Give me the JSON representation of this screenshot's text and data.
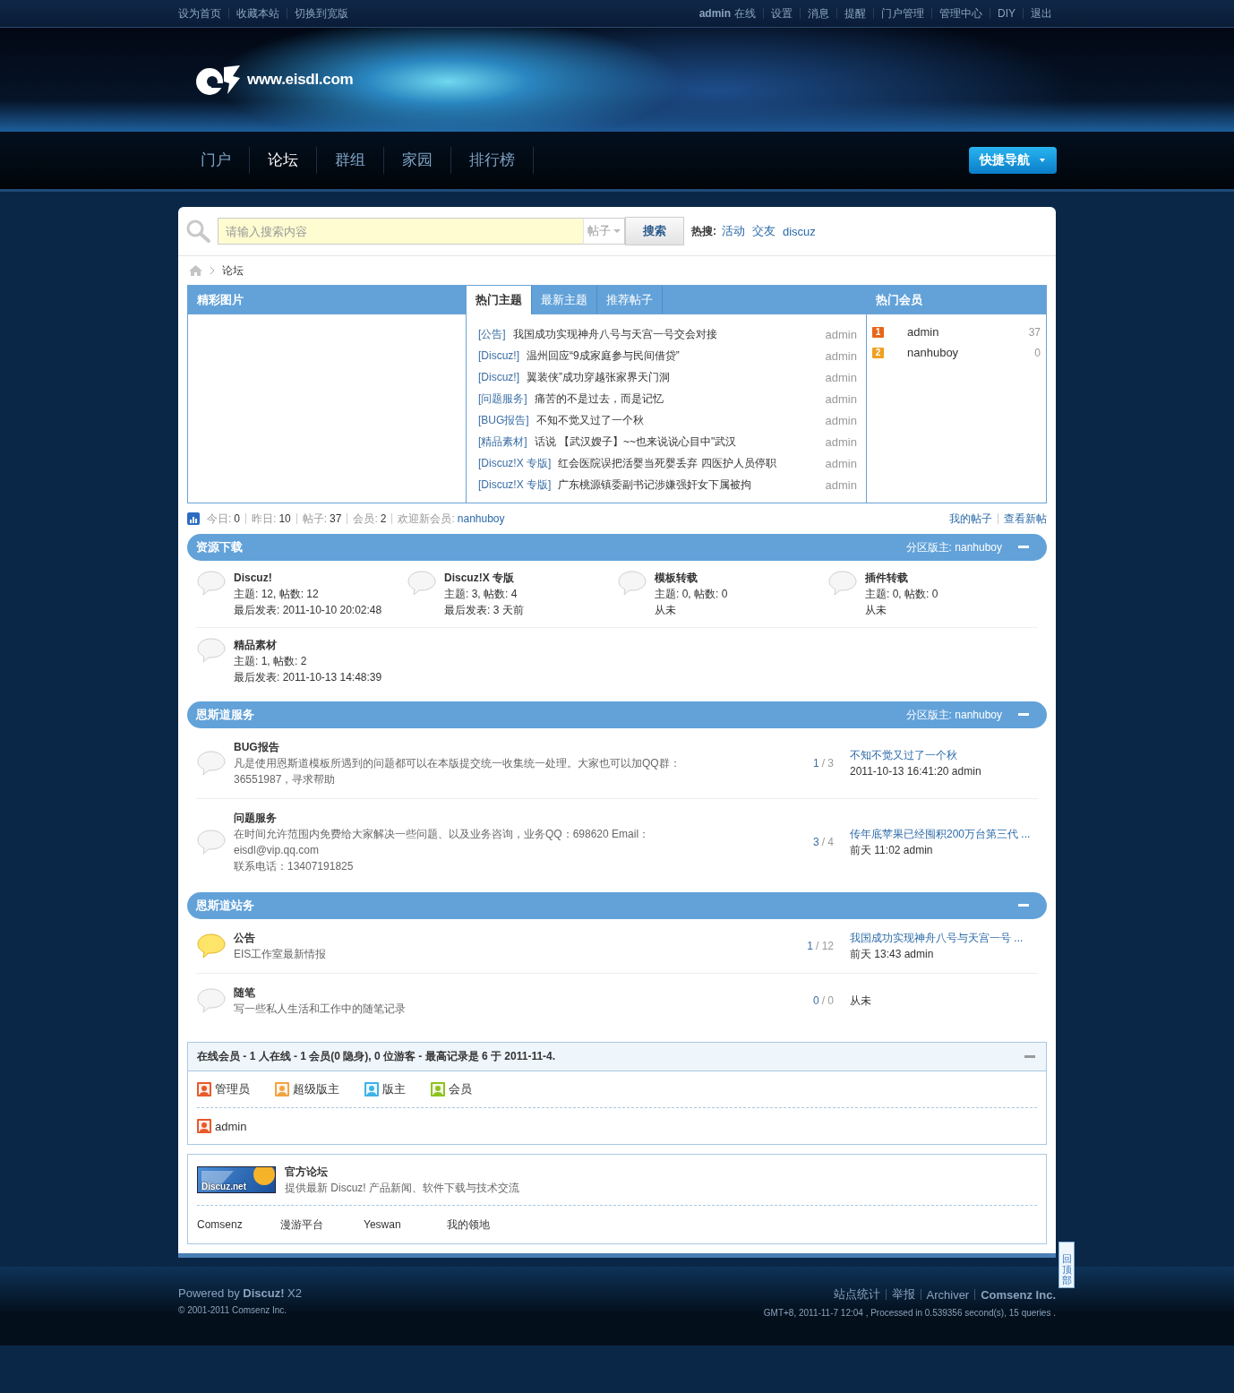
{
  "topbar": {
    "left_links": [
      "设为首页",
      "收藏本站",
      "切换到宽版"
    ],
    "user": "admin",
    "status": "在线",
    "right_links": [
      "设置",
      "消息",
      "提醒",
      "门户管理",
      "管理中心",
      "DIY",
      "退出"
    ]
  },
  "header": {
    "logo_text": "www.eisdl.com"
  },
  "nav": {
    "items": [
      {
        "label": "门户",
        "selected": false
      },
      {
        "label": "论坛",
        "selected": true
      },
      {
        "label": "群组",
        "selected": false
      },
      {
        "label": "家园",
        "selected": false
      },
      {
        "label": "排行榜",
        "selected": false
      }
    ],
    "quick_nav": "快捷导航"
  },
  "search": {
    "placeholder": "请输入搜索内容",
    "scope": "帖子",
    "button": "搜索",
    "hot_label": "热搜:",
    "hot": [
      "活动",
      "交友",
      "discuz"
    ]
  },
  "breadcrumb": [
    "论坛"
  ],
  "pictures": {
    "title": "精彩图片"
  },
  "topics": {
    "tabs": [
      {
        "label": "热门主题",
        "selected": true
      },
      {
        "label": "最新主题",
        "selected": false
      },
      {
        "label": "推荐帖子",
        "selected": false
      }
    ],
    "rows": [
      {
        "tag": "[公告]",
        "title": "我国成功实现神舟八号与天宫一号交会对接",
        "author": "admin"
      },
      {
        "tag": "[Discuz!]",
        "title": "温州回应“9成家庭参与民间借贷”",
        "author": "admin"
      },
      {
        "tag": "[Discuz!]",
        "title": "翼装侠”成功穿越张家界天门洞",
        "author": "admin"
      },
      {
        "tag": "[问题服务]",
        "title": "痛苦的不是过去，而是记忆",
        "author": "admin"
      },
      {
        "tag": "[BUG报告]",
        "title": "不知不觉又过了一个秋",
        "author": "admin"
      },
      {
        "tag": "[精品素材]",
        "title": "话说 【武汉嫂子】~~也来说说心目中\"武汉",
        "author": "admin"
      },
      {
        "tag": "[Discuz!X 专版]",
        "title": "红会医院误把活婴当死婴丢弃 四医护人员停职",
        "author": "admin"
      },
      {
        "tag": "[Discuz!X 专版]",
        "title": "广东桃源镇委副书记涉嫌强奸女下属被拘",
        "author": "admin"
      }
    ]
  },
  "members": {
    "title": "热门会员",
    "rows": [
      {
        "rank": "1",
        "color": "#e8641b",
        "name": "admin",
        "count": "37"
      },
      {
        "rank": "2",
        "color": "#f0a020",
        "name": "nanhuboy",
        "count": "0"
      }
    ]
  },
  "stats": {
    "items": [
      {
        "label": "今日:",
        "value": "0"
      },
      {
        "label": "昨日:",
        "value": "10"
      },
      {
        "label": "帖子:",
        "value": "37"
      },
      {
        "label": "会员:",
        "value": "2"
      }
    ],
    "welcome_label": "欢迎新会员:",
    "newest": "nanhuboy",
    "links": [
      "我的帖子",
      "查看新帖"
    ]
  },
  "categories": [
    {
      "title": "资源下载",
      "moderator": "分区版主: nanhuboy",
      "kind": "grid",
      "forums": [
        {
          "name": "Discuz!",
          "stats": "主题: 12, 帖数: 12",
          "last": "最后发表: 2011-10-10 20:02:48"
        },
        {
          "name": "Discuz!X 专版",
          "stats": "主题: 3, 帖数: 4",
          "last": "最后发表: 3 天前"
        },
        {
          "name": "模板转载",
          "stats": "主题: 0, 帖数: 0",
          "last": "从未"
        },
        {
          "name": "插件转载",
          "stats": "主题: 0, 帖数: 0",
          "last": "从未"
        },
        {
          "name": "精品素材",
          "stats": "主题: 1, 帖数: 2",
          "last": "最后发表: 2011-10-13 14:48:39"
        }
      ]
    },
    {
      "title": "恩斯道服务",
      "moderator": "分区版主: nanhuboy",
      "kind": "list",
      "forums": [
        {
          "name": "BUG报告",
          "new": false,
          "desc": [
            "凡是使用恩斯道模板所遇到的问题都可以在本版提交统一收集统一处理。大家也可以加QQ群：",
            "36551987，寻求帮助"
          ],
          "today": "1",
          "total": "/ 3",
          "last_title": "不知不觉又过了一个秋",
          "last_meta": "2011-10-13 16:41:20 admin"
        },
        {
          "name": "问题服务",
          "new": false,
          "desc": [
            "在时间允许范围内免费给大家解决一些问题、以及业务咨询，业务QQ：698620 Email：",
            "eisdl@vip.qq.com",
            "联系电话：13407191825"
          ],
          "today": "3",
          "total": "/ 4",
          "last_title": "传年底苹果已经囤积200万台第三代 ...",
          "last_meta": "前天 11:02 admin"
        }
      ]
    },
    {
      "title": "恩斯道站务",
      "kind": "list",
      "forums": [
        {
          "name": "公告",
          "new": true,
          "desc": [
            "EIS工作室最新情报"
          ],
          "today": "1",
          "total": "/ 12",
          "last_title": "我国成功实现神舟八号与天宫一号 ...",
          "last_meta": "前天 13:43 admin"
        },
        {
          "name": "随笔",
          "new": false,
          "desc": [
            "写一些私人生活和工作中的随笔记录"
          ],
          "today": "0",
          "total": "/ 0",
          "last_meta": "从未"
        }
      ]
    }
  ],
  "online": {
    "title": "在线会员 - 1 人在线 - 1 会员(0 隐身), 0 位游客 - 最高记录是 6 于 2011-11-4.",
    "legend": [
      {
        "label": "管理员",
        "color": "#e8592a"
      },
      {
        "label": "超级版主",
        "color": "#f2a444"
      },
      {
        "label": "版主",
        "color": "#3fb2e6"
      },
      {
        "label": "会员",
        "color": "#8dc21f"
      }
    ],
    "users": [
      {
        "name": "admin",
        "color": "#e8592a"
      }
    ]
  },
  "links": {
    "logo_text": "Discuz.net",
    "name": "官方论坛",
    "desc": "提供最新 Discuz! 产品新闻、软件下载与技术交流",
    "text_links": [
      "Comsenz",
      "漫游平台",
      "Yeswan",
      "我的领地"
    ]
  },
  "footer": {
    "powered": "Powered by **Discuz!** X2",
    "copyright": "© 2001-2011 Comsenz Inc.",
    "links": [
      {
        "label": "站点统计",
        "bold": false
      },
      {
        "label": "举报",
        "bold": false
      },
      {
        "label": "Archiver",
        "bold": false
      },
      {
        "label": "Comsenz Inc.",
        "bold": true
      }
    ],
    "meta": "GMT+8, 2011-11-7 12:04 , Processed in 0.539356 second(s), 15 queries ."
  },
  "back_to_top": "回顶部"
}
